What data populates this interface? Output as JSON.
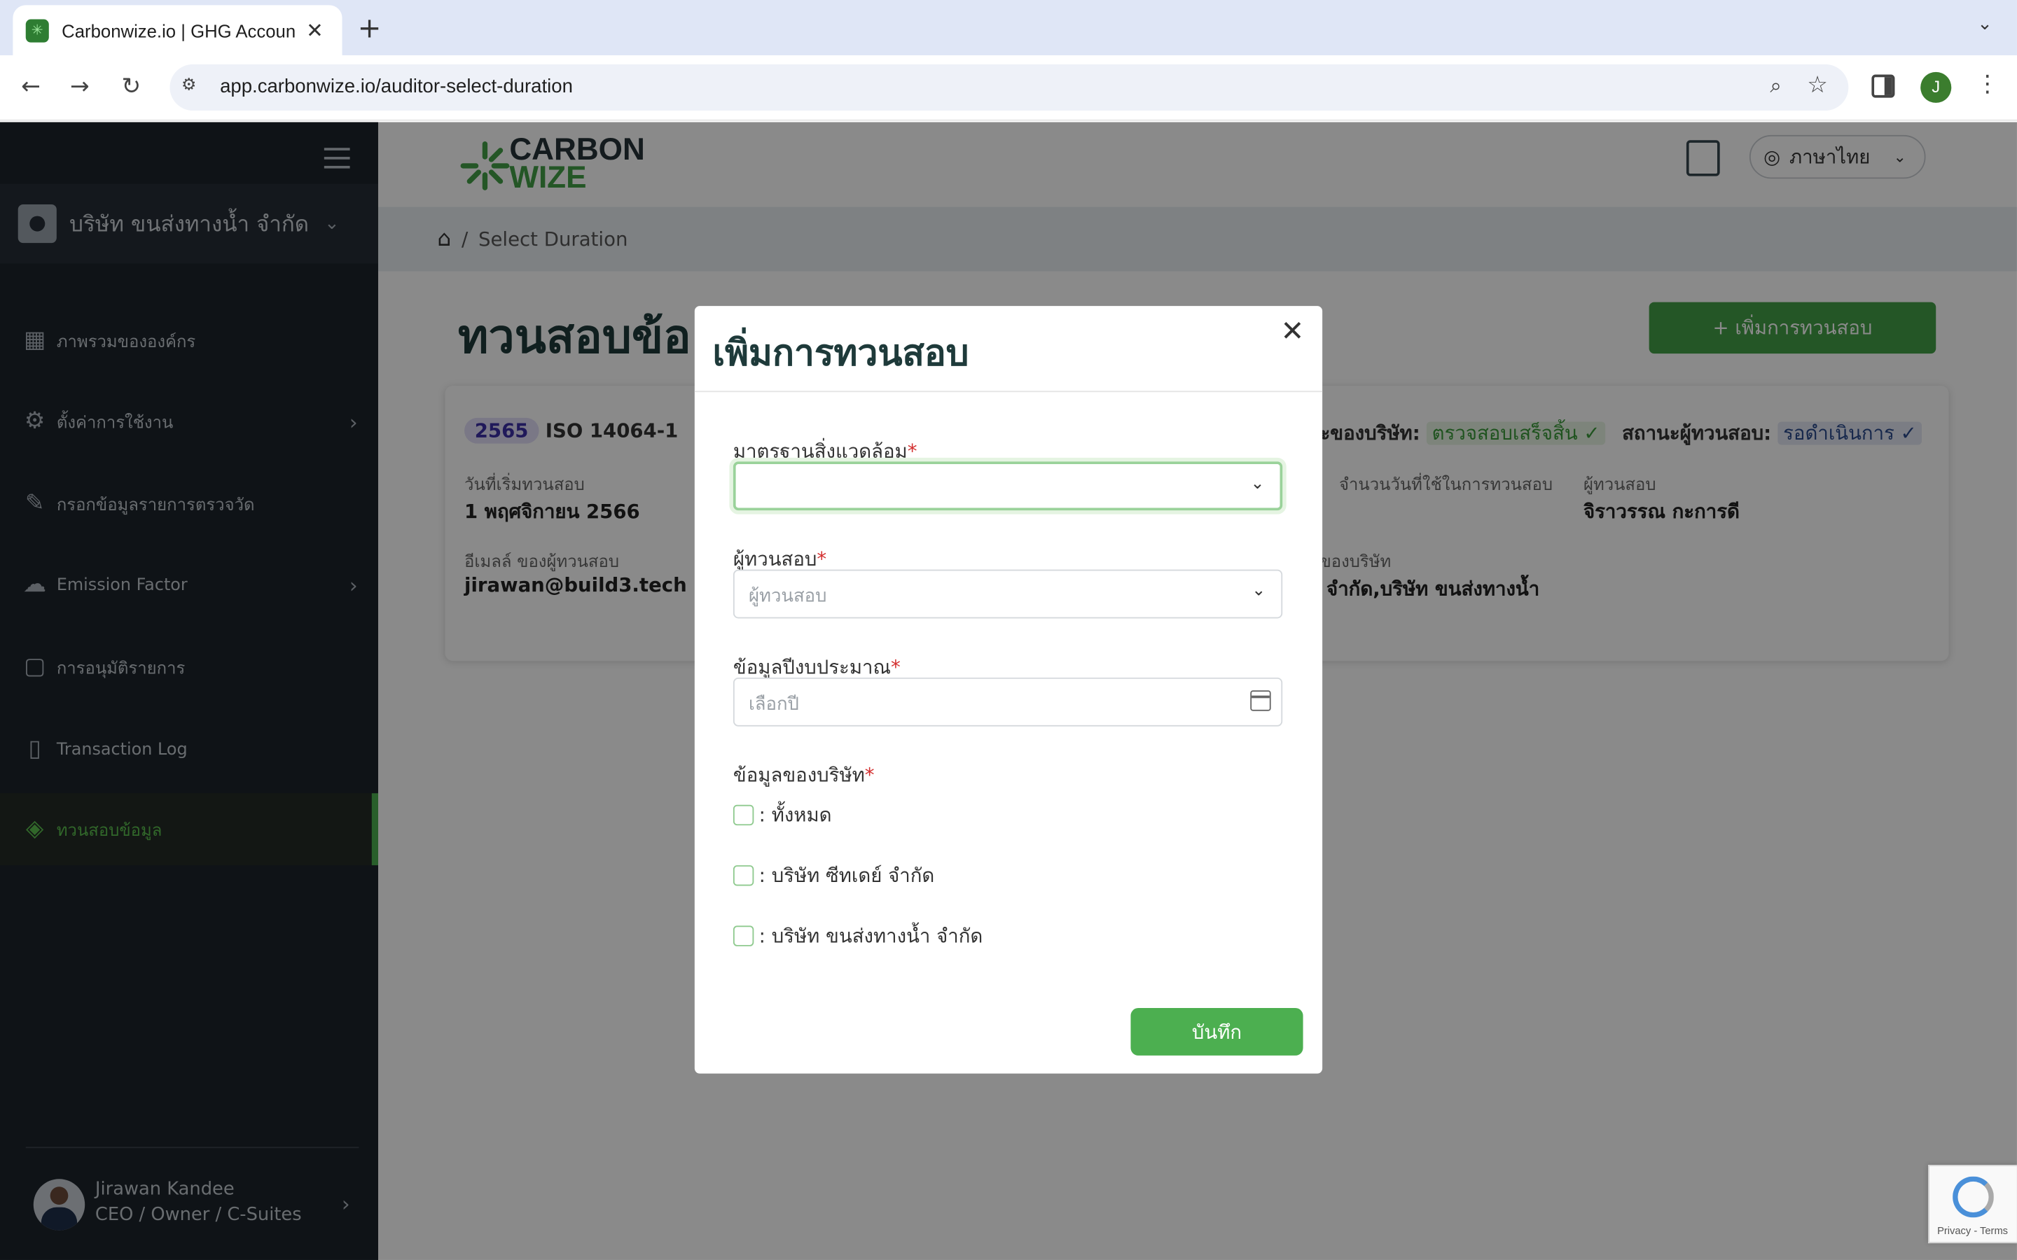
{
  "browser": {
    "tab_title": "Carbonwize.io | GHG Accoun",
    "url": "app.carbonwize.io/auditor-select-duration",
    "profile_initial": "J"
  },
  "sidebar": {
    "company": "บริษัท ขนส่งทางน้ำ จำกัด",
    "items": [
      {
        "label": "ภาพรวมขององค์กร",
        "icon": "dashboard-icon"
      },
      {
        "label": "ตั้งค่าการใช้งาน",
        "icon": "gear-icon"
      },
      {
        "label": "กรอกข้อมูลรายการตรวจวัด",
        "icon": "pencil-icon"
      },
      {
        "label": "Emission Factor",
        "icon": "cloud-icon"
      },
      {
        "label": "การอนุมัติรายการ",
        "icon": "approval-icon"
      },
      {
        "label": "Transaction Log",
        "icon": "clipboard-icon"
      },
      {
        "label": "ทวนสอบข้อมูล",
        "icon": "verify-icon"
      }
    ],
    "user": {
      "name": "Jirawan Kandee",
      "role": "CEO / Owner / C-Suites"
    }
  },
  "header": {
    "logo_top": "CARBON",
    "logo_bottom": "WIZE",
    "language": "ภาษาไทย"
  },
  "breadcrumb": {
    "current": "Select Duration"
  },
  "page": {
    "title": "ทวนสอบข้อ",
    "add_button": "+ เพิ่มการทวนสอบ"
  },
  "card": {
    "year": "2565",
    "standard": "ISO 14064-1",
    "company_status_label": "ะของบริษัท:",
    "company_status": "ตรวจสอบเสร็จสิ้น ✓",
    "auditor_status_label": "สถานะผู้ทวนสอบ:",
    "auditor_status": "รอดำเนินการ ✓",
    "start_label": "วันที่เริ่มทวนสอบ",
    "start_value": "1 พฤศจิกายน 2566",
    "days_label": "จำนวนวันที่ใช้ในการทวนสอบ",
    "auditor_label": "ผู้ทวนสอบ",
    "auditor_value": "จิราวรรณ กะการดี",
    "email_label": "อีเมลล์ ของผู้ทวนสอบ",
    "email_value": "jirawan@build3.tech",
    "companies_label": "ของบริษัท",
    "companies_value": "่ จำกัด,บริษัท ขนส่งทางน้ำ"
  },
  "modal": {
    "title": "เพิ่มการทวนสอบ",
    "standard_label": "มาตรฐานสิ่งแวดล้อม",
    "auditor_label": "ผู้ทวนสอบ",
    "auditor_placeholder": "ผู้ทวนสอบ",
    "budget_label": "ข้อมูลปีงบประมาณ",
    "budget_placeholder": "เลือกปี",
    "company_label": "ข้อมูลของบริษัท",
    "options": [
      ": ทั้งหมด",
      ": บริษัท ซีทเดย์ จำกัด",
      ": บริษัท ขนส่งทางน้ำ จำกัด"
    ],
    "save": "บันทึก"
  },
  "recaptcha": {
    "text": "Privacy - Terms"
  }
}
